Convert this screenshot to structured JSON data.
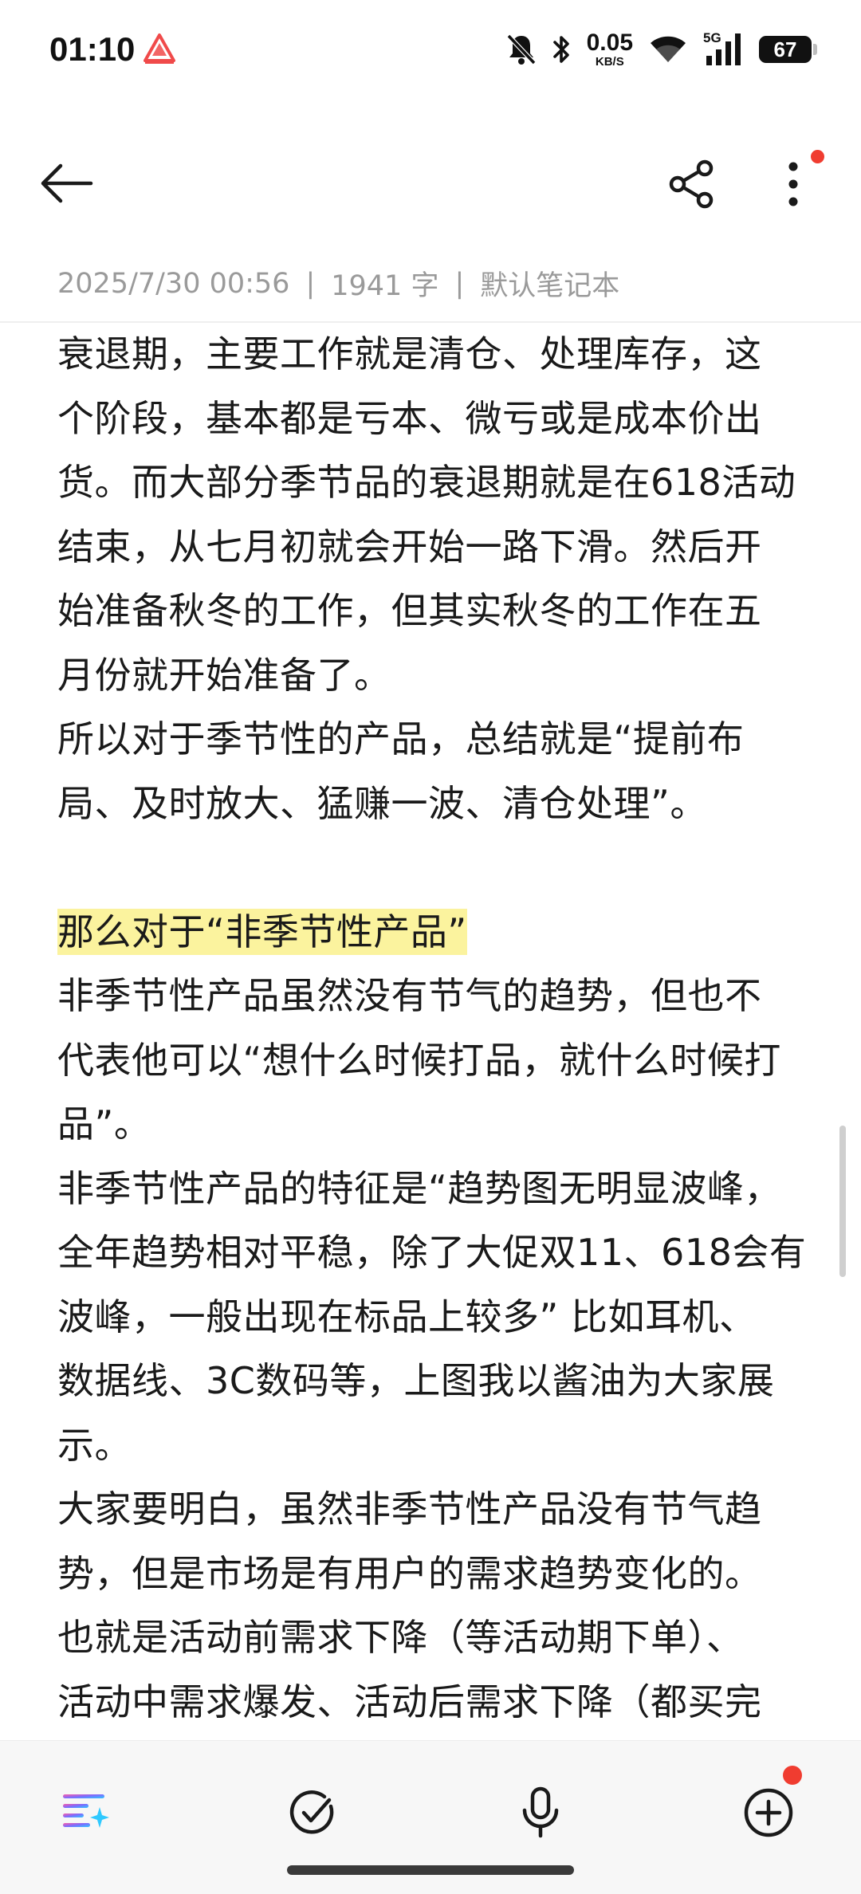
{
  "status_bar": {
    "time": "01:10",
    "net_speed_value": "0.05",
    "net_speed_unit": "KB/S",
    "network_type": "5G",
    "battery": "67"
  },
  "icons": {
    "app_notification": "triangle-logo-icon",
    "mute": "bell-off-icon",
    "bluetooth": "bluetooth-icon",
    "wifi": "wifi-icon",
    "signal": "signal-bars-icon",
    "back": "arrow-left-icon",
    "share": "share-icon",
    "more": "more-vertical-icon",
    "format": "ai-format-icon",
    "todo": "check-circle-icon",
    "mic": "microphone-icon",
    "add": "plus-circle-icon"
  },
  "colors": {
    "highlight": "#fbf39e",
    "badge": "#f03c30",
    "meta_text": "#9a9a9a",
    "ai_gradient": [
      "#ff5ca8",
      "#7a6cff",
      "#2fc9ff"
    ]
  },
  "meta": {
    "datetime": "2025/7/30 00:56",
    "separator": "|",
    "word_count": "1941 字",
    "notebook": "默认笔记本"
  },
  "note": {
    "lines": [
      "衰退期，主要工作就是清仓、处理库存，这",
      "个阶段，基本都是亏本、微亏或是成本价出",
      "货。而大部分季节品的衰退期就是在618活动",
      "结束，从七月初就会开始一路下滑。然后开",
      "始准备秋冬的工作，但其实秋冬的工作在五",
      "月份就开始准备了。",
      "所以对于季节性的产品，总结就是“提前布",
      "局、及时放大、猛赚一波、清仓处理”。",
      "",
      "那么对于“非季节性产品”",
      "非季节性产品虽然没有节气的趋势，但也不",
      "代表他可以“想什么时候打品，就什么时候打",
      "品”。",
      "非季节性产品的特征是“趋势图无明显波峰，",
      "全年趋势相对平稳，除了大促双11、618会有",
      "波峰，一般出现在标品上较多” 比如耳机、",
      "数据线、3C数码等，上图我以酱油为大家展",
      "示。",
      "大家要明白，虽然非季节性产品没有节气趋",
      "势，但是市场是有用户的需求趋势变化的。",
      "也就是活动前需求下降（等活动期下单）、",
      "活动中需求爆发、活动后需求下降（都买完"
    ]
  }
}
